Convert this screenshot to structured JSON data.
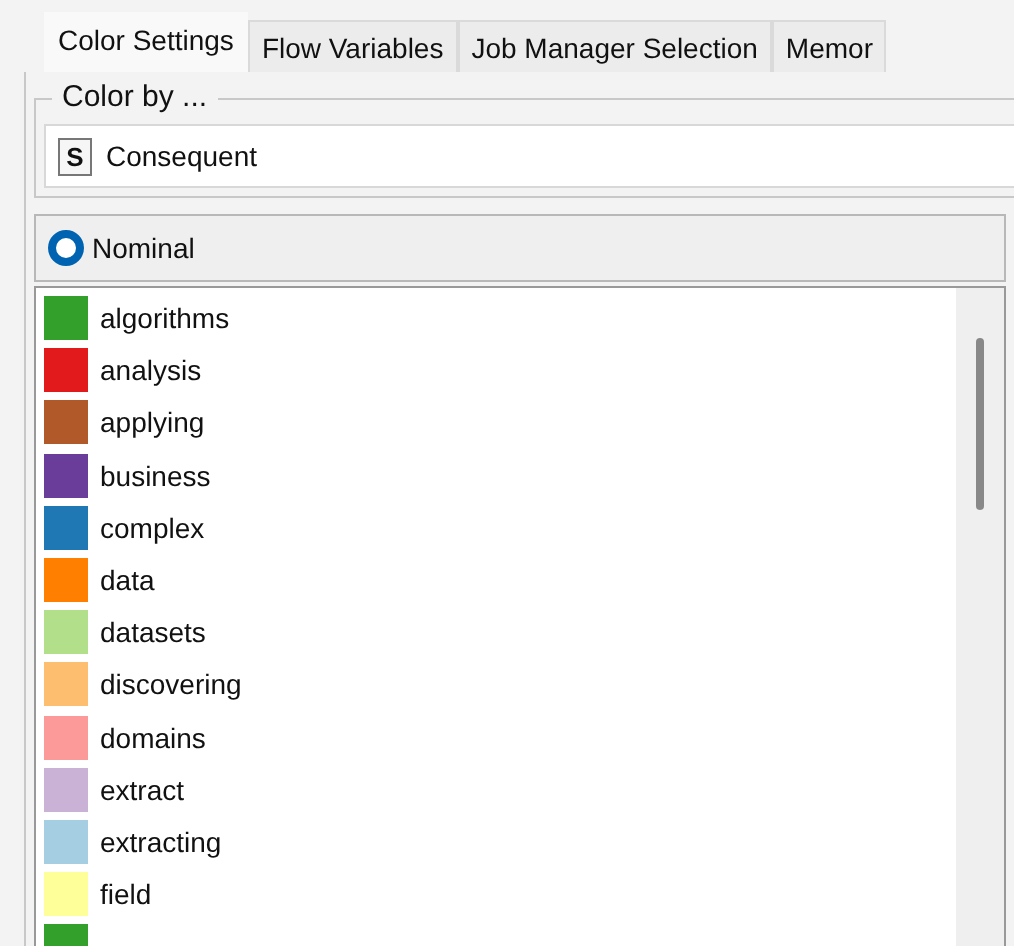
{
  "tabs": [
    {
      "label": "Color Settings",
      "selected": true
    },
    {
      "label": "Flow Variables",
      "selected": false
    },
    {
      "label": "Job Manager Selection",
      "selected": false
    },
    {
      "label": "Memor",
      "selected": false
    }
  ],
  "color_by": {
    "title": "Color by ...",
    "type_badge": "S",
    "column": "Consequent"
  },
  "mode": {
    "label": "Nominal",
    "selected": true
  },
  "values": [
    {
      "label": "algorithms",
      "color": "#33a02c"
    },
    {
      "label": "analysis",
      "color": "#e31a1c"
    },
    {
      "label": "applying",
      "color": "#b15928"
    },
    {
      "label": "business",
      "color": "#6a3d9a"
    },
    {
      "label": "complex",
      "color": "#1f78b4"
    },
    {
      "label": "data",
      "color": "#ff7f00"
    },
    {
      "label": "datasets",
      "color": "#b2df8a"
    },
    {
      "label": "discovering",
      "color": "#fdbf6f"
    },
    {
      "label": "domains",
      "color": "#fb9a99"
    },
    {
      "label": "extract",
      "color": "#cab2d6"
    },
    {
      "label": "extracting",
      "color": "#a6cee3"
    },
    {
      "label": "field",
      "color": "#ffff99"
    },
    {
      "color": "#33a02c"
    }
  ]
}
